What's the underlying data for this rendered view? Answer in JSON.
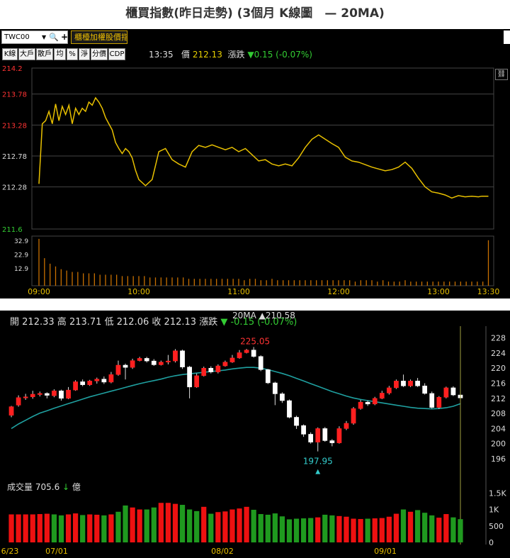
{
  "title": "櫃買指數(昨日走勢) (3個月 K線圖　— 20MA)",
  "intraday": {
    "symbol": "TWC00",
    "market_label": "櫃檯加權股價指",
    "buttons": [
      "K線",
      "大戶",
      "散戶",
      "均",
      "%",
      "淨",
      "分價",
      "CDP"
    ],
    "time": "13:35",
    "price_label": "價",
    "price": "212.13",
    "change_label": "漲跌",
    "change": "▼0.15 (-0.07%)",
    "colors": {
      "line": "#e8c000",
      "grid": "#444444",
      "red": "#ff3333",
      "green": "#22aa22"
    },
    "chart_data": {
      "type": "line",
      "ylim": [
        211.6,
        214.2
      ],
      "y_ticks": [
        "214.2",
        "213.78",
        "213.28",
        "212.78",
        "212.28",
        "211.6"
      ],
      "x_ticks": [
        "09:00",
        "10:00",
        "11:00",
        "12:00",
        "13:00",
        "13:30"
      ],
      "x_minutes": [
        0,
        2,
        4,
        6,
        8,
        10,
        12,
        14,
        16,
        18,
        20,
        22,
        24,
        26,
        28,
        30,
        32,
        34,
        36,
        38,
        40,
        42,
        44,
        46,
        48,
        50,
        52,
        54,
        56,
        58,
        60,
        64,
        68,
        72,
        76,
        80,
        84,
        88,
        92,
        96,
        100,
        104,
        108,
        112,
        116,
        120,
        124,
        128,
        132,
        136,
        140,
        144,
        148,
        152,
        156,
        160,
        164,
        168,
        172,
        176,
        180,
        184,
        188,
        192,
        196,
        200,
        204,
        208,
        212,
        216,
        220,
        224,
        228,
        232,
        236,
        240,
        244,
        248,
        252,
        256,
        260,
        264,
        266,
        270
      ],
      "values": [
        212.33,
        213.3,
        213.35,
        213.5,
        213.3,
        213.62,
        213.35,
        213.58,
        213.45,
        213.6,
        213.3,
        213.55,
        213.45,
        213.55,
        213.5,
        213.65,
        213.6,
        213.72,
        213.65,
        213.55,
        213.4,
        213.3,
        213.2,
        213.0,
        212.9,
        212.82,
        212.9,
        212.85,
        212.75,
        212.55,
        212.4,
        212.3,
        212.4,
        212.85,
        212.9,
        212.72,
        212.65,
        212.6,
        212.85,
        212.95,
        212.92,
        212.96,
        212.92,
        212.88,
        212.92,
        212.85,
        212.9,
        212.8,
        212.7,
        212.72,
        212.65,
        212.62,
        212.65,
        212.62,
        212.75,
        212.92,
        213.05,
        213.12,
        213.05,
        212.98,
        212.92,
        212.76,
        212.7,
        212.68,
        212.64,
        212.6,
        212.57,
        212.54,
        212.56,
        212.6,
        212.68,
        212.58,
        212.42,
        212.28,
        212.2,
        212.18,
        212.15,
        212.1,
        212.14,
        212.12,
        212.13,
        212.12,
        212.13,
        212.13
      ],
      "volume_ticks": [
        "32.9",
        "22.9",
        "12.9"
      ],
      "volume_max": 36,
      "volume": [
        34,
        20,
        16,
        14,
        12,
        11,
        10,
        10,
        9,
        9,
        9,
        8,
        8,
        8,
        8,
        7,
        7,
        7,
        7,
        7,
        6,
        6,
        6,
        6,
        6,
        6,
        6,
        5,
        5,
        5,
        5,
        5,
        5,
        5,
        5,
        5,
        5,
        4,
        5,
        5,
        4,
        4,
        5,
        4,
        4,
        4,
        4,
        4,
        4,
        4,
        4,
        4,
        4,
        4,
        4,
        4,
        4,
        3,
        4,
        4,
        4,
        3,
        4,
        3,
        3,
        3,
        4,
        3,
        3,
        3,
        3,
        3,
        3,
        3,
        3,
        3,
        3,
        3,
        3,
        3,
        3,
        33
      ]
    }
  },
  "daily": {
    "header": {
      "open_label": "開",
      "open": "212.33",
      "high_label": "高",
      "high": "213.71",
      "low_label": "低",
      "low": "212.06",
      "close_label": "收",
      "close": "212.13",
      "change_label": "漲跌",
      "change": "▼ -0.15 (-0.07%)"
    },
    "ma_label": "20MA",
    "ma_value": "▲210.58",
    "volume_label": "成交量",
    "volume_value": "705.6",
    "volume_arrow": "↓",
    "volume_unit": "億",
    "chart_data": {
      "type": "candlestick",
      "ylim": [
        193,
        230
      ],
      "y_ticks": [
        228,
        224,
        220,
        216,
        212,
        208,
        204,
        200,
        196
      ],
      "x_ticks": [
        "6/23",
        "07/01",
        "08/02",
        "09/01"
      ],
      "high_annotation": "225.05",
      "low_annotation": "197.95",
      "candles": [
        [
          207.5,
          209.8,
          207.0,
          210.0
        ],
        [
          210.2,
          212.2,
          209.8,
          212.8
        ],
        [
          212.1,
          212.4,
          211.6,
          213.2
        ],
        [
          212.4,
          213.1,
          211.9,
          214.0
        ],
        [
          213.0,
          213.3,
          212.5,
          213.8
        ],
        [
          213.3,
          212.8,
          212.0,
          213.6
        ],
        [
          212.7,
          214.0,
          212.3,
          214.4
        ],
        [
          214.0,
          212.0,
          211.4,
          214.3
        ],
        [
          212.0,
          214.2,
          211.8,
          215.0
        ],
        [
          214.2,
          216.4,
          214.0,
          216.8
        ],
        [
          216.4,
          215.6,
          215.2,
          217.0
        ],
        [
          215.6,
          216.6,
          215.3,
          216.9
        ],
        [
          216.6,
          217.1,
          215.9,
          217.5
        ],
        [
          217.1,
          216.3,
          215.8,
          217.8
        ],
        [
          216.3,
          218.3,
          216.0,
          219.0
        ],
        [
          218.3,
          220.8,
          218.0,
          222.0
        ],
        [
          220.8,
          220.2,
          217.0,
          221.2
        ],
        [
          220.2,
          222.0,
          219.8,
          222.5
        ],
        [
          222.0,
          222.6,
          221.8,
          223.0
        ],
        [
          222.6,
          221.9,
          221.5,
          223.0
        ],
        [
          221.9,
          220.9,
          220.6,
          222.4
        ],
        [
          220.9,
          221.6,
          220.7,
          222.0
        ],
        [
          221.6,
          221.9,
          221.0,
          223.5
        ],
        [
          221.9,
          224.6,
          221.5,
          225.05
        ],
        [
          224.6,
          220.3,
          219.8,
          224.9
        ],
        [
          220.3,
          215.0,
          212.0,
          220.6
        ],
        [
          215.0,
          218.0,
          214.8,
          218.6
        ],
        [
          218.0,
          220.0,
          217.8,
          220.4
        ],
        [
          220.0,
          219.0,
          218.6,
          220.5
        ],
        [
          219.0,
          220.6,
          218.6,
          221.0
        ],
        [
          220.6,
          221.6,
          220.4,
          222.0
        ],
        [
          221.6,
          222.7,
          221.4,
          223.5
        ],
        [
          222.7,
          224.1,
          222.5,
          224.8
        ],
        [
          224.1,
          224.8,
          223.9,
          225.1
        ],
        [
          224.8,
          223.1,
          222.8,
          225.6
        ],
        [
          223.1,
          219.6,
          219.2,
          223.4
        ],
        [
          219.6,
          216.1,
          215.8,
          219.8
        ],
        [
          216.1,
          213.2,
          210.2,
          216.4
        ],
        [
          213.2,
          211.4,
          210.8,
          213.6
        ],
        [
          211.4,
          207.0,
          206.7,
          211.7
        ],
        [
          207.0,
          204.8,
          203.9,
          207.4
        ],
        [
          204.8,
          202.5,
          201.8,
          205.1
        ],
        [
          202.5,
          200.4,
          200.0,
          203.0
        ],
        [
          200.4,
          204.0,
          197.95,
          204.3
        ],
        [
          204.0,
          200.8,
          200.5,
          204.4
        ],
        [
          200.8,
          200.2,
          199.3,
          201.2
        ],
        [
          200.2,
          204.0,
          200.0,
          204.6
        ],
        [
          204.0,
          205.4,
          203.6,
          206.0
        ],
        [
          205.4,
          209.3,
          205.0,
          209.7
        ],
        [
          209.3,
          211.0,
          209.0,
          211.6
        ],
        [
          211.0,
          210.5,
          210.0,
          211.4
        ],
        [
          210.5,
          212.0,
          210.2,
          212.4
        ],
        [
          212.0,
          213.4,
          211.8,
          214.0
        ],
        [
          213.4,
          214.8,
          213.0,
          215.3
        ],
        [
          214.8,
          216.6,
          214.5,
          217.0
        ],
        [
          216.6,
          215.3,
          215.0,
          218.3
        ],
        [
          215.3,
          216.6,
          215.0,
          217.0
        ],
        [
          216.6,
          215.3,
          215.0,
          217.4
        ],
        [
          215.3,
          213.3,
          213.0,
          216.0
        ],
        [
          213.3,
          209.6,
          209.3,
          213.8
        ],
        [
          209.6,
          212.3,
          209.2,
          212.6
        ],
        [
          212.3,
          214.8,
          212.0,
          215.1
        ],
        [
          214.8,
          212.9,
          212.6,
          215.2
        ],
        [
          212.9,
          212.1,
          211.6,
          213.3
        ]
      ],
      "ma20": [
        204.0,
        205.2,
        206.2,
        207.2,
        208.1,
        208.7,
        209.4,
        210.0,
        210.6,
        211.2,
        211.8,
        212.4,
        212.9,
        213.4,
        213.9,
        214.4,
        214.9,
        215.4,
        215.9,
        216.3,
        216.7,
        217.1,
        217.6,
        218.0,
        218.3,
        218.5,
        218.7,
        218.9,
        219.1,
        219.3,
        219.5,
        219.8,
        220.0,
        220.2,
        220.2,
        220.0,
        219.6,
        219.1,
        218.6,
        218.0,
        217.3,
        216.6,
        215.9,
        215.2,
        214.5,
        213.8,
        213.2,
        212.6,
        212.1,
        211.7,
        211.4,
        211.1,
        210.8,
        210.5,
        210.2,
        209.9,
        209.6,
        209.4,
        209.3,
        209.2,
        209.3,
        209.5,
        209.9,
        210.58
      ],
      "volume_ticks": [
        "1.5K",
        "1K",
        "500",
        "0"
      ],
      "volume_max": 1700,
      "volume": [
        850,
        850,
        850,
        850,
        860,
        870,
        850,
        820,
        850,
        880,
        830,
        850,
        840,
        820,
        850,
        930,
        1120,
        1060,
        1000,
        1000,
        1060,
        1200,
        1200,
        1170,
        1140,
        1000,
        950,
        1080,
        870,
        920,
        940,
        1000,
        1030,
        1080,
        990,
        860,
        840,
        880,
        790,
        700,
        720,
        730,
        740,
        760,
        840,
        820,
        800,
        780,
        720,
        710,
        720,
        730,
        740,
        780,
        870,
        1000,
        930,
        980,
        900,
        820,
        750,
        860,
        760,
        705.6
      ],
      "volume_colors": [
        "r",
        "r",
        "r",
        "r",
        "r",
        "r",
        "g",
        "g",
        "r",
        "r",
        "g",
        "r",
        "r",
        "g",
        "r",
        "g",
        "g",
        "r",
        "r",
        "g",
        "g",
        "r",
        "r",
        "r",
        "g",
        "g",
        "g",
        "r",
        "g",
        "r",
        "r",
        "r",
        "r",
        "r",
        "g",
        "g",
        "g",
        "g",
        "g",
        "g",
        "g",
        "g",
        "g",
        "r",
        "g",
        "g",
        "r",
        "r",
        "r",
        "r",
        "g",
        "r",
        "r",
        "r",
        "r",
        "g",
        "r",
        "g",
        "g",
        "g",
        "r",
        "r",
        "g",
        "g"
      ]
    }
  }
}
